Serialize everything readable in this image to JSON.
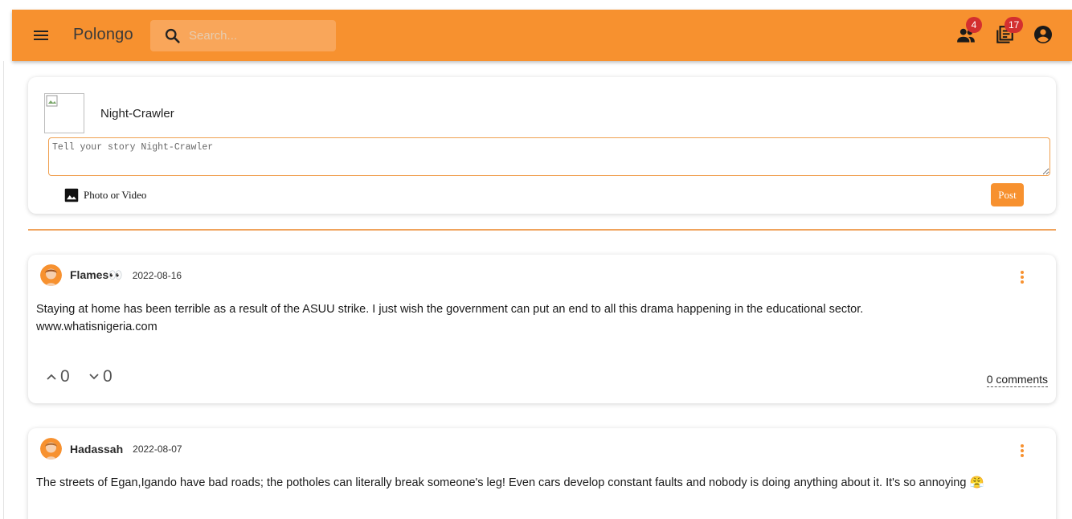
{
  "app": {
    "brand": "Polongo"
  },
  "search": {
    "placeholder": "Search..."
  },
  "nav": {
    "friends_badge": "4",
    "posts_badge": "17",
    "icons": [
      "menu-icon",
      "search-icon",
      "people-icon",
      "library-books-icon",
      "account-circle-icon"
    ]
  },
  "composer": {
    "username": "Night-Crawler",
    "placeholder": "Tell your story Night-Crawler",
    "photo_label": "Photo or Video",
    "post_label": "Post"
  },
  "posts": [
    {
      "user": "Flames👀",
      "date": "2022-08-16",
      "text": "Staying at home has been terrible as a result of the ASUU strike. I just wish the government can put an end to all this drama happening in the educational sector.",
      "link": "www.whatisnigeria.com",
      "upvotes": "0",
      "downvotes": "0",
      "comments": "0 comments"
    },
    {
      "user": "Hadassah",
      "date": "2022-08-07",
      "text": "The streets of Egan,Igando have bad roads; the potholes can literally break someone's leg! Even cars develop constant faults and nobody is doing anything about it. It's so annoying 😤"
    }
  ],
  "colors": {
    "accent": "#f7912f",
    "search_bg": "#f9a65a",
    "badge": "#d32f2f"
  }
}
